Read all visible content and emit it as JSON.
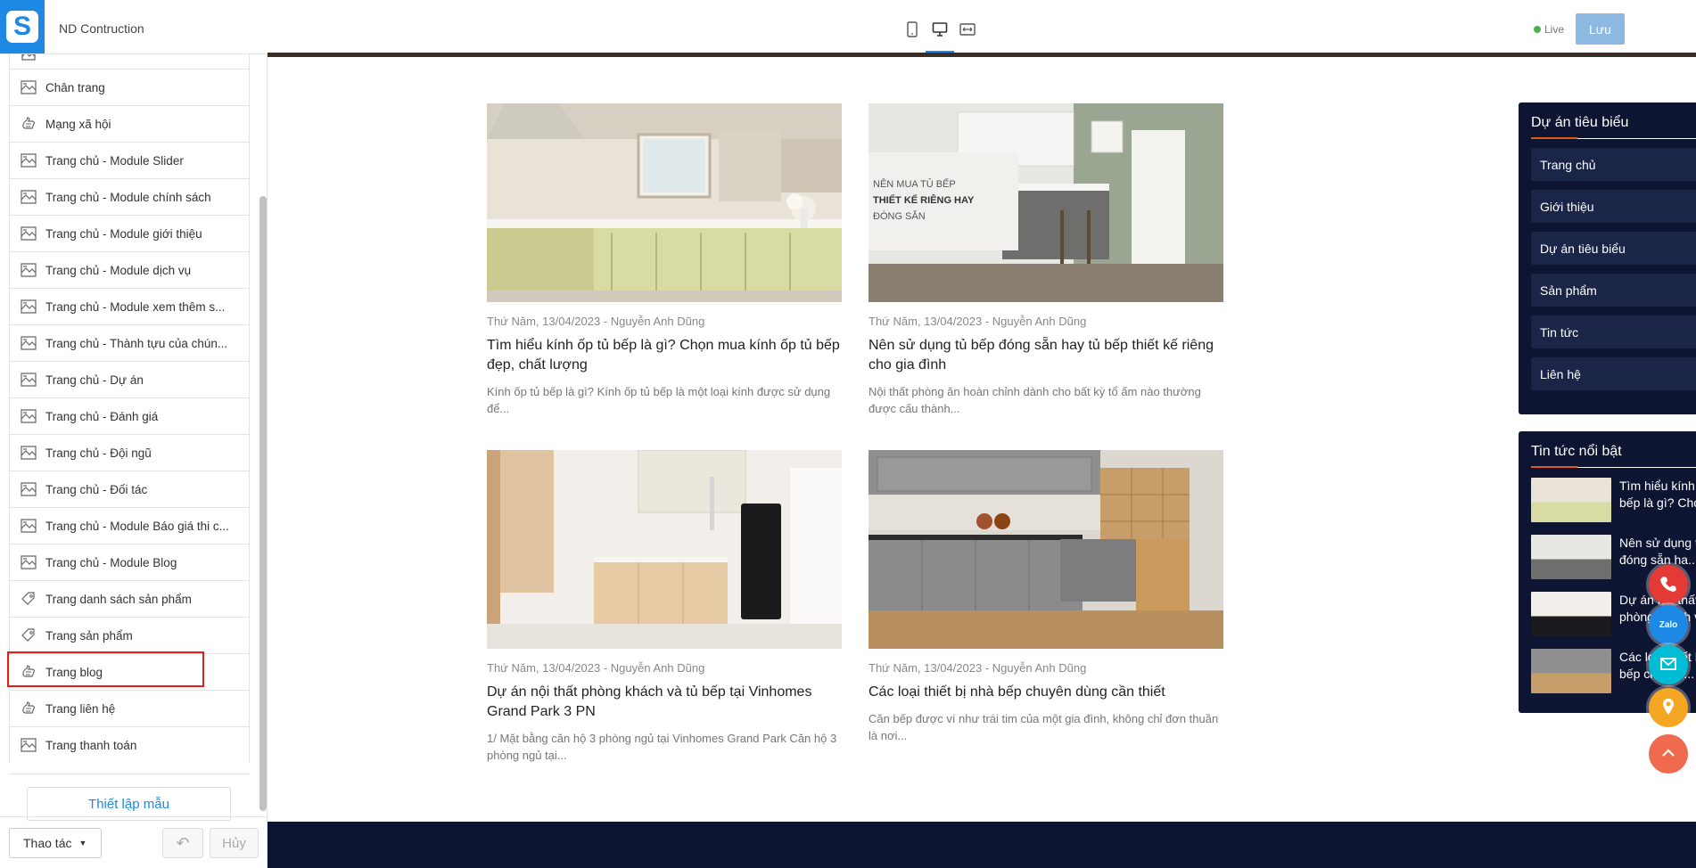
{
  "app": {
    "site_name": "ND Contruction",
    "logo_letter": "S"
  },
  "sidebar": {
    "items": [
      {
        "label": "Chân trang",
        "icon": "layout-image-icon"
      },
      {
        "label": "Mạng xã hội",
        "icon": "hand-icon"
      },
      {
        "label": "Trang chủ - Module Slider",
        "icon": "layout-image-icon"
      },
      {
        "label": "Trang chủ - Module chính sách",
        "icon": "layout-image-icon"
      },
      {
        "label": "Trang chủ - Module giới thiệu",
        "icon": "layout-image-icon"
      },
      {
        "label": "Trang chủ - Module dịch vụ",
        "icon": "layout-image-icon"
      },
      {
        "label": "Trang chủ - Module xem thêm s...",
        "icon": "layout-image-icon"
      },
      {
        "label": "Trang chủ - Thành tựu của chún...",
        "icon": "layout-image-icon"
      },
      {
        "label": "Trang chủ - Dự án",
        "icon": "layout-image-icon"
      },
      {
        "label": "Trang chủ - Đánh giá",
        "icon": "layout-image-icon"
      },
      {
        "label": "Trang chủ - Đội ngũ",
        "icon": "layout-image-icon"
      },
      {
        "label": "Trang chủ - Đối tác",
        "icon": "layout-image-icon"
      },
      {
        "label": "Trang chủ - Module Báo giá thi c...",
        "icon": "layout-image-icon"
      },
      {
        "label": "Trang chủ - Module Blog",
        "icon": "layout-image-icon"
      },
      {
        "label": "Trang danh sách sản phẩm",
        "icon": "tag-icon"
      },
      {
        "label": "Trang sản phẩm",
        "icon": "tag-icon"
      },
      {
        "label": "Trang blog",
        "icon": "hand-icon"
      },
      {
        "label": "Trang liên hệ",
        "icon": "hand-icon"
      },
      {
        "label": "Trang thanh toán",
        "icon": "layout-image-icon"
      }
    ],
    "selected": "Trang blog",
    "template_button": "Thiết lập mẫu",
    "actions_button": "Thao tác",
    "cancel_button": "Hủy"
  },
  "topbar": {
    "devices": [
      "mobile-icon",
      "desktop-icon",
      "fullwidth-icon"
    ],
    "active_device": "desktop-icon",
    "live_label": "Live",
    "save_label": "Lưu"
  },
  "posts": [
    {
      "meta": "Thứ Năm, 13/04/2023 - Nguyễn Anh Dũng",
      "title": "Tìm hiểu kính ốp tủ bếp là gì? Chọn mua kính ốp tủ bếp đẹp, chất lượng",
      "excerpt": "Kính ốp tủ bếp là gì? Kính ốp tủ bếp là một loại kính được sử dụng để..."
    },
    {
      "meta": "Thứ Năm, 13/04/2023 - Nguyễn Anh Dũng",
      "title": "Nên sử dụng tủ bếp đóng sẵn hay tủ bếp thiết kế riêng cho gia đình",
      "excerpt": "Nội thất phòng ăn hoàn chỉnh dành cho bất kỳ tổ ấm nào thường được cấu thành...",
      "image_text": [
        "NÊN MUA TỦ BẾP",
        "THIẾT KẾ RIÊNG HAY",
        "ĐÓNG SẴN"
      ]
    },
    {
      "meta": "Thứ Năm, 13/04/2023 - Nguyễn Anh Dũng",
      "title": "Dự án nội thất phòng khách và tủ bếp tại Vinhomes Grand Park 3 PN",
      "excerpt": "1/ Mặt bằng căn hộ 3 phòng ngủ tại Vinhomes Grand Park Căn hộ 3 phòng ngủ tại..."
    },
    {
      "meta": "Thứ Năm, 13/04/2023 - Nguyễn Anh Dũng",
      "title": "Các loại thiết bị nhà bếp chuyên dùng cần thiết",
      "excerpt": "Căn bếp được ví như trái tim của một gia đình, không chỉ đơn thuần là nơi..."
    }
  ],
  "widget_projects": {
    "title": "Dự án tiêu biểu",
    "items": [
      {
        "label": "Trang chủ",
        "has_children": false
      },
      {
        "label": "Giới thiệu",
        "has_children": false
      },
      {
        "label": "Dự án tiêu biểu",
        "has_children": true
      },
      {
        "label": "Sản phẩm",
        "has_children": true
      },
      {
        "label": "Tin tức",
        "has_children": false
      },
      {
        "label": "Liên hệ",
        "has_children": false
      }
    ]
  },
  "widget_news": {
    "title": "Tin tức nổi bật",
    "items": [
      {
        "label": "Tìm hiểu kính ốp tủ bếp là gì? Chọn..."
      },
      {
        "label": "Nên sử dụng tủ bếp đóng sẵn ha..."
      },
      {
        "label": "Dự án nội thất phòng khách và t..."
      },
      {
        "label": "Các loại thiết bị nhà bếp chuyên..."
      }
    ]
  },
  "float_buttons": [
    {
      "name": "phone-icon",
      "color": "#e53935"
    },
    {
      "name": "zalo-icon",
      "color": "#1e88e5",
      "label": "Zalo"
    },
    {
      "name": "mail-icon",
      "color": "#00bcd4"
    },
    {
      "name": "location-icon",
      "color": "#f5a623"
    },
    {
      "name": "scroll-top-icon",
      "color": "#f06a50"
    }
  ],
  "colors": {
    "brand": "#1e88e5",
    "widget_bg": "#0d1533",
    "accent": "#e05a1a",
    "save": "#8db8e2"
  }
}
